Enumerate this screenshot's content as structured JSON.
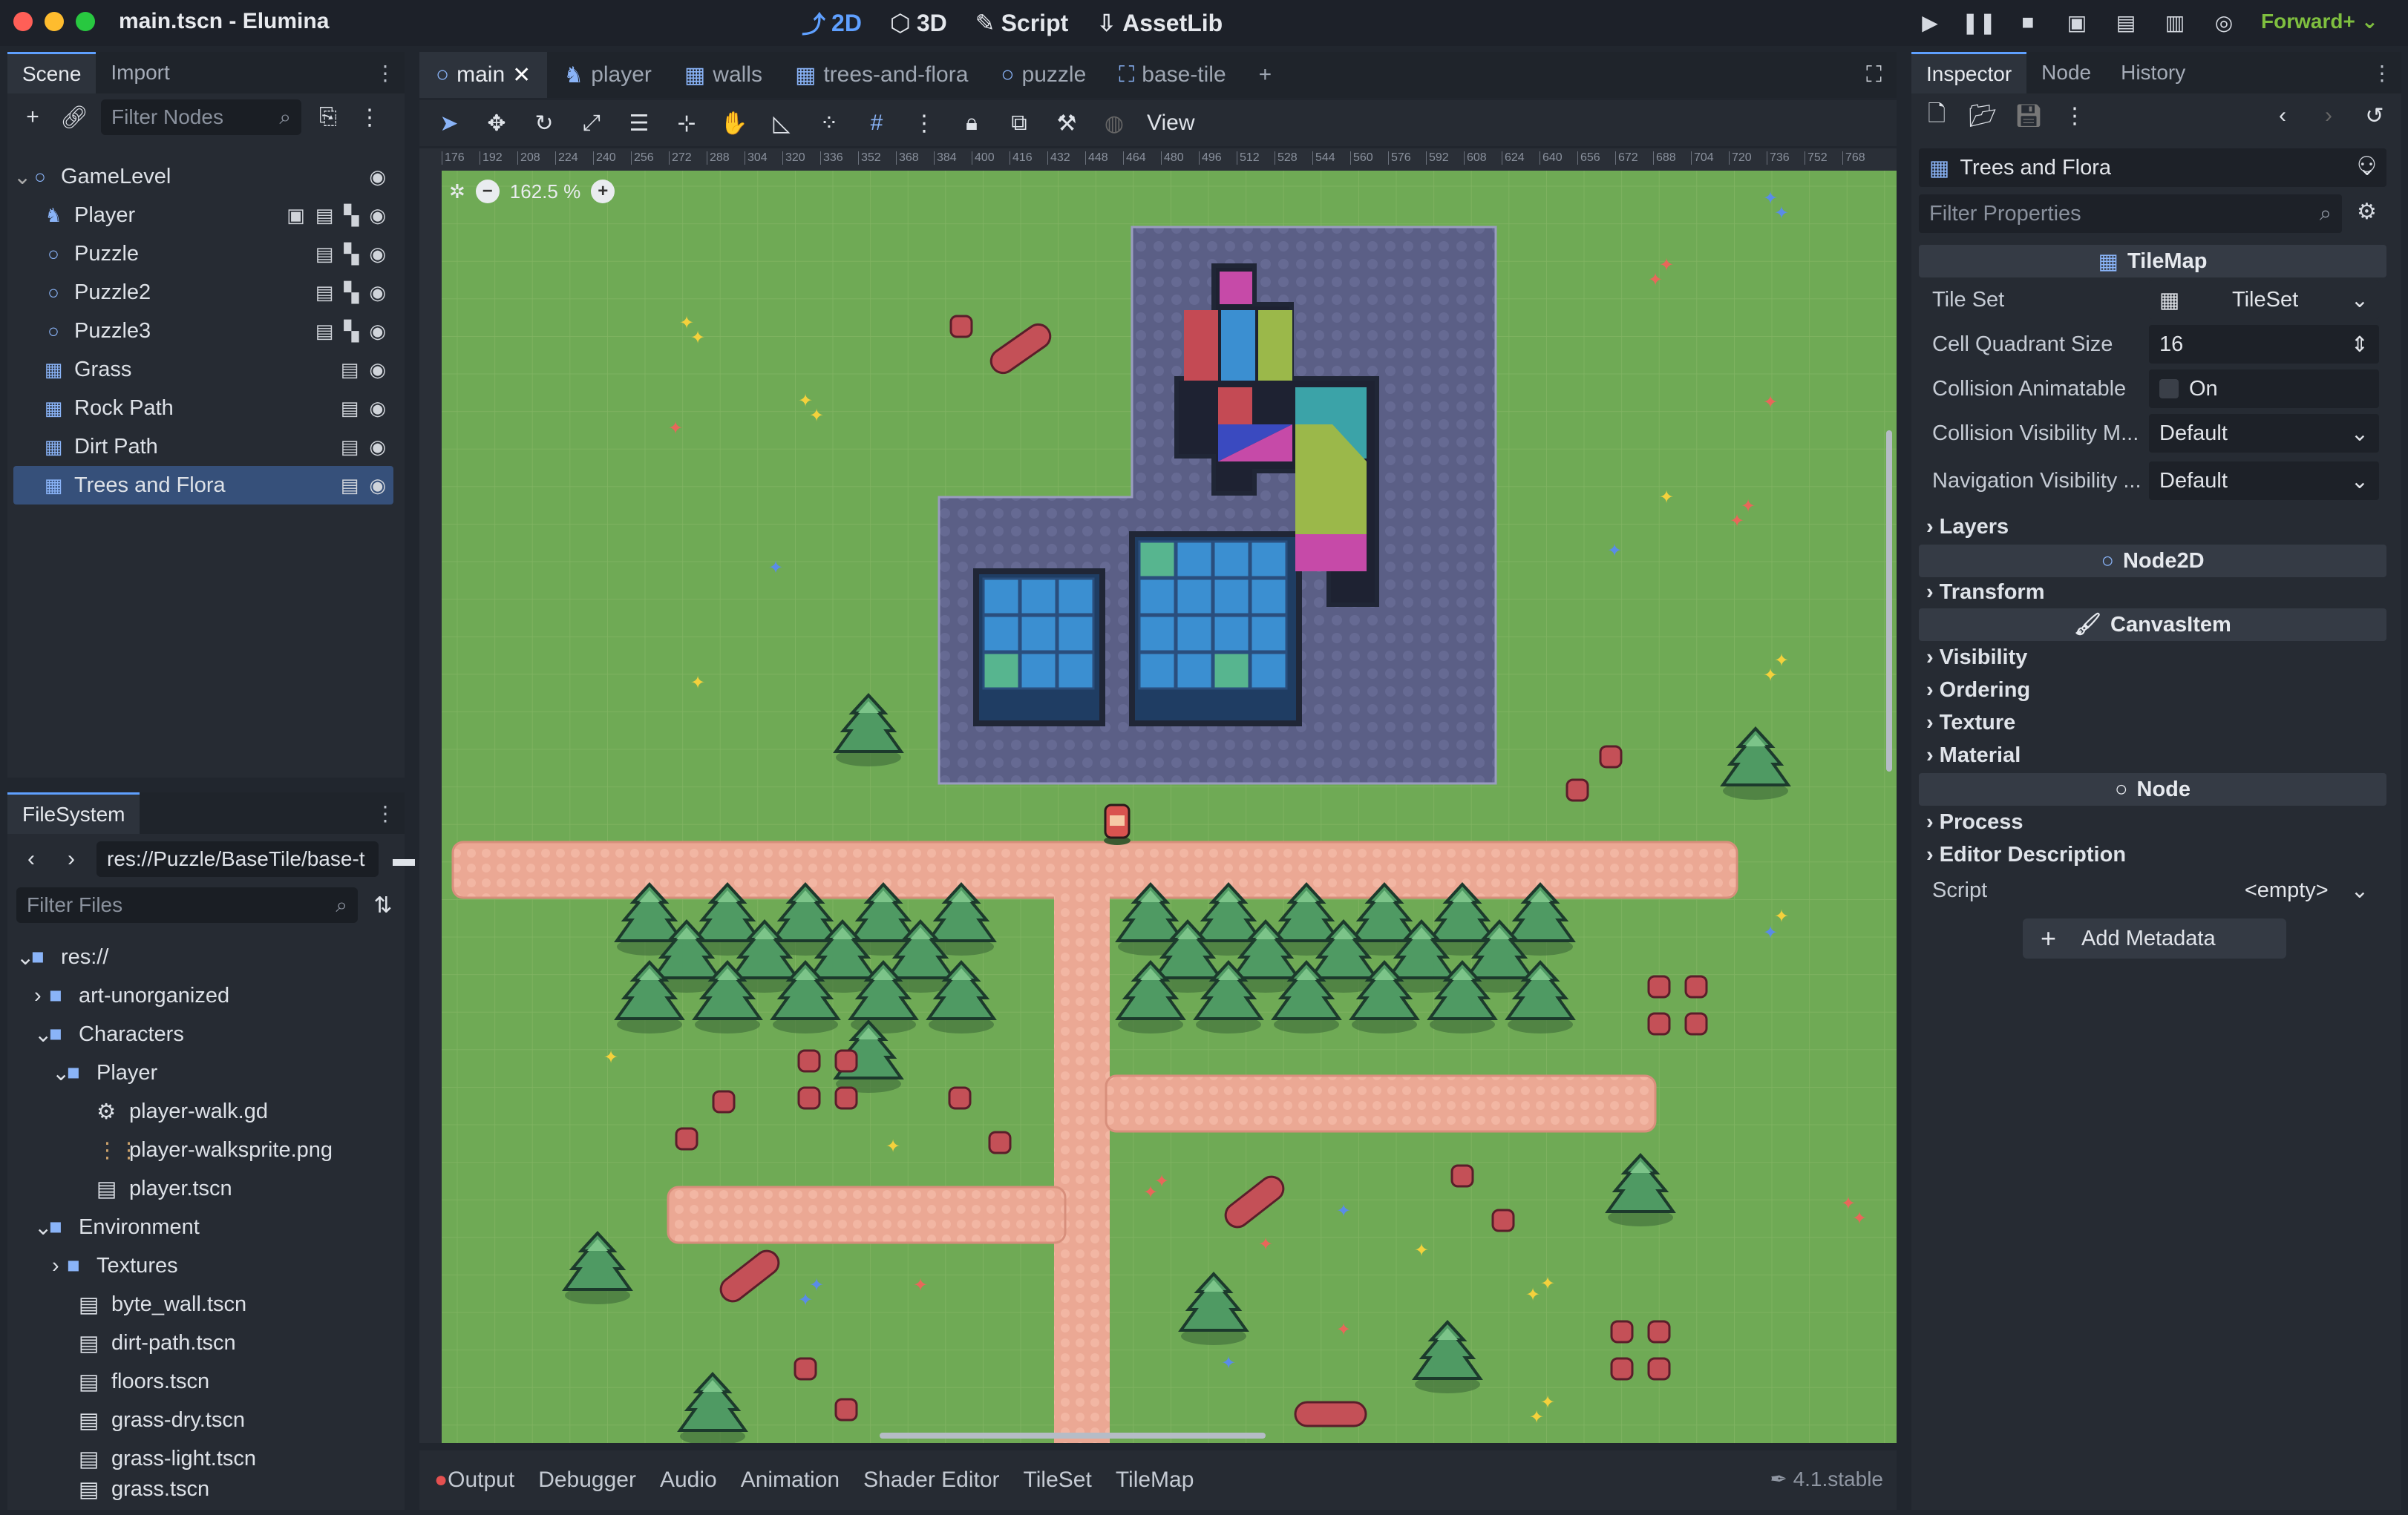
{
  "window": {
    "title": "main.tscn - Elumina",
    "renderer": "Forward+"
  },
  "modes": [
    {
      "label": "2D",
      "icon": "2d-icon"
    },
    {
      "label": "3D",
      "icon": "3d-icon"
    },
    {
      "label": "Script",
      "icon": "script-icon"
    },
    {
      "label": "AssetLib",
      "icon": "assetlib-icon"
    }
  ],
  "scene_panel": {
    "tabs": [
      "Scene",
      "Import"
    ],
    "filter_placeholder": "Filter Nodes",
    "nodes": [
      {
        "label": "GameLevel",
        "icon": "node2d-icon"
      },
      {
        "label": "Player",
        "icon": "character-icon"
      },
      {
        "label": "Puzzle",
        "icon": "node2d-icon"
      },
      {
        "label": "Puzzle2",
        "icon": "node2d-icon"
      },
      {
        "label": "Puzzle3",
        "icon": "node2d-icon"
      },
      {
        "label": "Grass",
        "icon": "tilemap-icon"
      },
      {
        "label": "Rock Path",
        "icon": "tilemap-icon"
      },
      {
        "label": "Dirt Path",
        "icon": "tilemap-icon"
      },
      {
        "label": "Trees and Flora",
        "icon": "tilemap-icon",
        "selected": true
      }
    ]
  },
  "filesystem": {
    "tab": "FileSystem",
    "path": "res://Puzzle/BaseTile/base-t",
    "filter_placeholder": "Filter Files",
    "items": [
      {
        "label": "res://",
        "type": "folder",
        "depth": 0
      },
      {
        "label": "art-unorganized",
        "type": "folder",
        "depth": 1
      },
      {
        "label": "Characters",
        "type": "folder",
        "depth": 1
      },
      {
        "label": "Player",
        "type": "folder",
        "depth": 2
      },
      {
        "label": "player-walk.gd",
        "type": "script",
        "depth": 3
      },
      {
        "label": "player-walksprite.png",
        "type": "image",
        "depth": 3
      },
      {
        "label": "player.tscn",
        "type": "scene",
        "depth": 3
      },
      {
        "label": "Environment",
        "type": "folder",
        "depth": 1
      },
      {
        "label": "Textures",
        "type": "folder",
        "depth": 2
      },
      {
        "label": "byte_wall.tscn",
        "type": "scene",
        "depth": 2
      },
      {
        "label": "dirt-path.tscn",
        "type": "scene",
        "depth": 2
      },
      {
        "label": "floors.tscn",
        "type": "scene",
        "depth": 2
      },
      {
        "label": "grass-dry.tscn",
        "type": "scene",
        "depth": 2
      },
      {
        "label": "grass-light.tscn",
        "type": "scene",
        "depth": 2
      },
      {
        "label": "grass.tscn",
        "type": "scene",
        "depth": 2
      }
    ]
  },
  "editor": {
    "tabs": [
      {
        "label": "main",
        "icon": "node2d-icon",
        "active": true
      },
      {
        "label": "player",
        "icon": "character-icon"
      },
      {
        "label": "walls",
        "icon": "tilemap-icon"
      },
      {
        "label": "trees-and-flora",
        "icon": "tilemap-icon"
      },
      {
        "label": "puzzle",
        "icon": "node2d-icon"
      },
      {
        "label": "base-tile",
        "icon": "sprite-icon"
      }
    ],
    "view_menu": "View",
    "zoom": "162.5 %",
    "ruler_ticks": [
      "176",
      "192",
      "208",
      "224",
      "240",
      "256",
      "272",
      "288",
      "304",
      "320",
      "336",
      "352",
      "368",
      "384",
      "400",
      "416",
      "432",
      "448",
      "464",
      "480",
      "496",
      "512",
      "528",
      "544",
      "560",
      "576",
      "592",
      "608",
      "624",
      "640",
      "656",
      "672",
      "688",
      "704",
      "720",
      "736",
      "752",
      "768"
    ]
  },
  "bottom_panel": {
    "tabs": [
      "Output",
      "Debugger",
      "Audio",
      "Animation",
      "Shader Editor",
      "TileSet",
      "TileMap"
    ],
    "version": "4.1.stable"
  },
  "inspector": {
    "tabs": [
      "Inspector",
      "Node",
      "History"
    ],
    "node_name": "Trees and Flora",
    "filter_placeholder": "Filter Properties",
    "class_header": "TileMap",
    "properties": [
      {
        "label": "Tile Set",
        "value": "TileSet"
      },
      {
        "label": "Cell Quadrant Size",
        "value": "16"
      },
      {
        "label": "Collision Animatable",
        "value": "On"
      },
      {
        "label": "Collision Visibility M...",
        "value": "Default"
      },
      {
        "label": "Navigation Visibility ...",
        "value": "Default"
      }
    ],
    "layers_section": "Layers",
    "node2d_header": "Node2D",
    "transform_section": "Transform",
    "canvasitem_header": "CanvasItem",
    "canvas_sections": [
      "Visibility",
      "Ordering",
      "Texture",
      "Material"
    ],
    "node_header": "Node",
    "node_sections": [
      "Process",
      "Editor Description"
    ],
    "script_label": "Script",
    "script_value": "<empty>",
    "add_metadata": "Add Metadata"
  }
}
